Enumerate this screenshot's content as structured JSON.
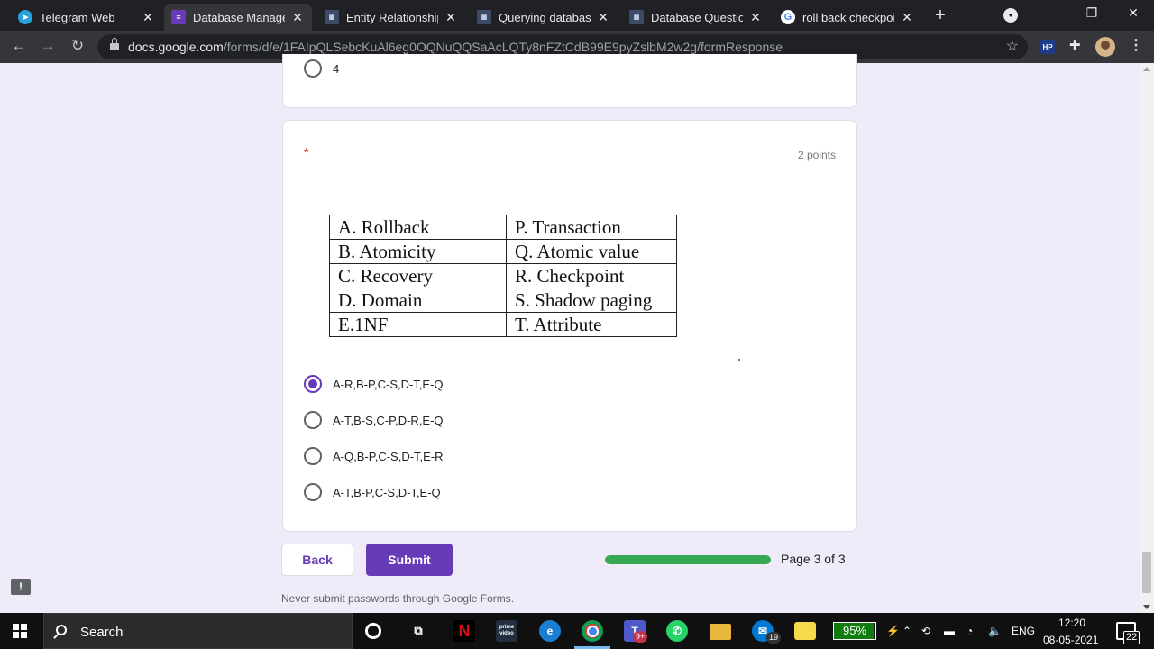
{
  "browser": {
    "tabs": [
      {
        "title": "Telegram Web",
        "icon": "telegram-icon",
        "active": false
      },
      {
        "title": "Database Managem",
        "icon": "google-forms-icon",
        "active": true
      },
      {
        "title": "Entity Relationship M",
        "icon": "module-icon",
        "active": false
      },
      {
        "title": "Querying database",
        "icon": "module-icon",
        "active": false
      },
      {
        "title": "Database Questions",
        "icon": "module-icon",
        "active": false
      },
      {
        "title": "roll back checkpoin",
        "icon": "google-icon",
        "active": false
      }
    ],
    "new_tab": "+",
    "url_host": "docs.google.com",
    "url_path": "/forms/d/e/1FAIpQLSebcKuAl6eg0OQNuQQSaAcLQTy8nFZtCdB99E9pyZslbM2w2g/formResponse",
    "extension_label": "HP"
  },
  "form": {
    "previous_option_label": "4",
    "required_mark": "*",
    "points": "2 points",
    "match_table": [
      {
        "left": "A. Rollback",
        "right": "P. Transaction"
      },
      {
        "left": "B. Atomicity",
        "right": "Q. Atomic value"
      },
      {
        "left": "C. Recovery",
        "right": "R. Checkpoint"
      },
      {
        "left": "D. Domain",
        "right": "S. Shadow paging"
      },
      {
        "left": "E.1NF",
        "right": "T. Attribute"
      }
    ],
    "options": [
      {
        "label": "A-R,B-P,C-S,D-T,E-Q",
        "selected": true
      },
      {
        "label": "A-T,B-S,C-P,D-R,E-Q",
        "selected": false
      },
      {
        "label": "A-Q,B-P,C-S,D-T,E-R",
        "selected": false
      },
      {
        "label": "A-T,B-P,C-S,D-T,E-Q",
        "selected": false
      }
    ],
    "back_label": "Back",
    "submit_label": "Submit",
    "progress_fraction": 1.0,
    "page_info": "Page 3 of 3",
    "disclaimer": "Never submit passwords through Google Forms.",
    "accent_color": "#673ab7",
    "progress_color": "#34a853"
  },
  "taskbar": {
    "search_label": "Search",
    "prime_label": "prime video",
    "teams_badge": "9+",
    "mail_badge": "19",
    "battery": "95%",
    "battery_fraction": 0.95,
    "language": "ENG",
    "time": "12:20",
    "date": "08-05-2021",
    "notifications": "22"
  }
}
